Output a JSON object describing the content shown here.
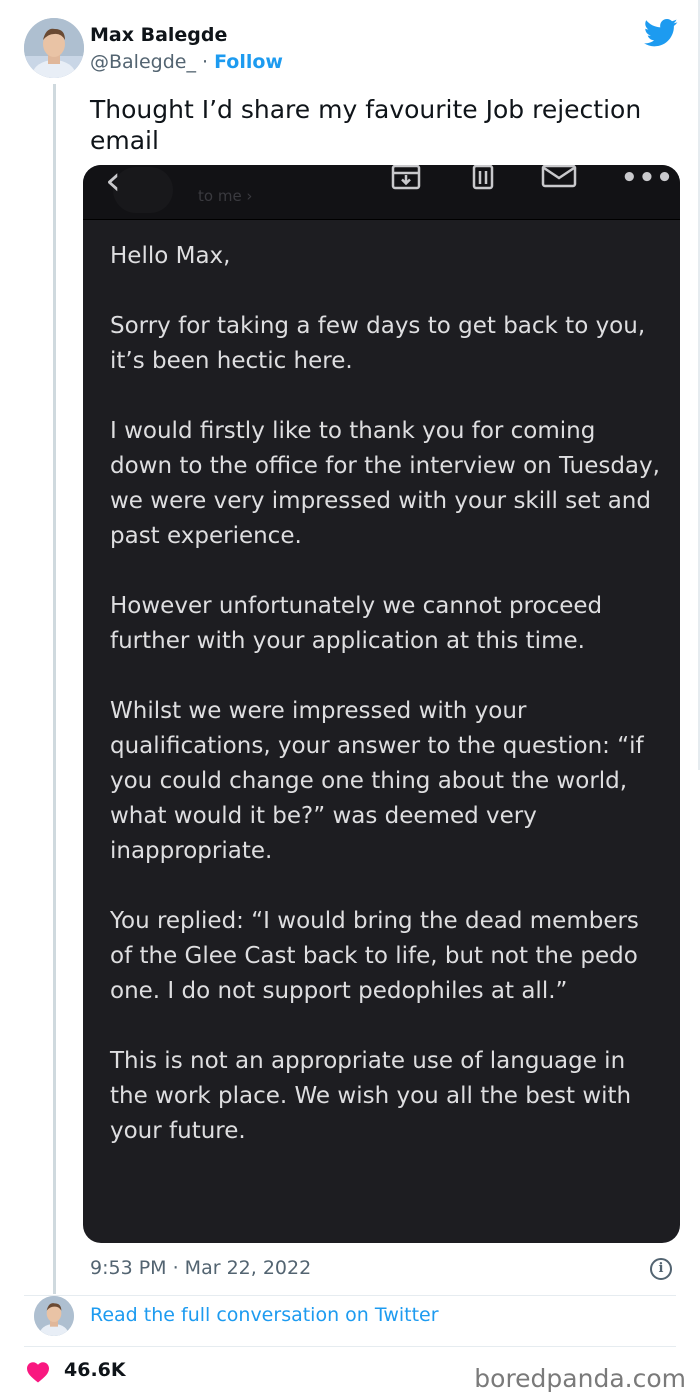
{
  "user": {
    "display_name": "Max Balegde",
    "handle": "@Balegde_",
    "separator": " · ",
    "follow_label": "Follow"
  },
  "tweet": {
    "text": "Thought I’d share my favourite Job rejection email",
    "timestamp": "9:53 PM · Mar 22, 2022",
    "read_full_label": "Read the full conversation on Twitter",
    "like_count": "46.6K"
  },
  "email": {
    "toolbar": {
      "back_icon": "chevron-left-icon",
      "faint_text": "to me ›",
      "icons": [
        "archive-icon",
        "trash-icon",
        "mail-icon",
        "more-icon"
      ]
    },
    "paragraphs": [
      "Hello Max,",
      "Sorry for taking a few days to get back to you, it’s been hectic here.",
      "I would firstly like to thank you for coming down to the office for the interview on Tuesday, we were very impressed with your skill set and past experience.",
      "However unfortunately we cannot proceed further with your application at this time.",
      "Whilst we were impressed with your qualifications, your answer to the question: “if you could change one thing about the world, what would it be?” was deemed very inappropriate.",
      "You replied: “I would bring the dead members of the Glee Cast back to life, but not the pedo one. I do not support pedophiles at all.”",
      "This is not an appropriate use of language in the work place. We wish you all the best with your future."
    ]
  },
  "watermark": "boredpanda.com",
  "colors": {
    "twitter_blue": "#1d9bf0",
    "heart_pink": "#f91880",
    "email_bg": "#1d1d21",
    "muted_text": "#536471"
  }
}
